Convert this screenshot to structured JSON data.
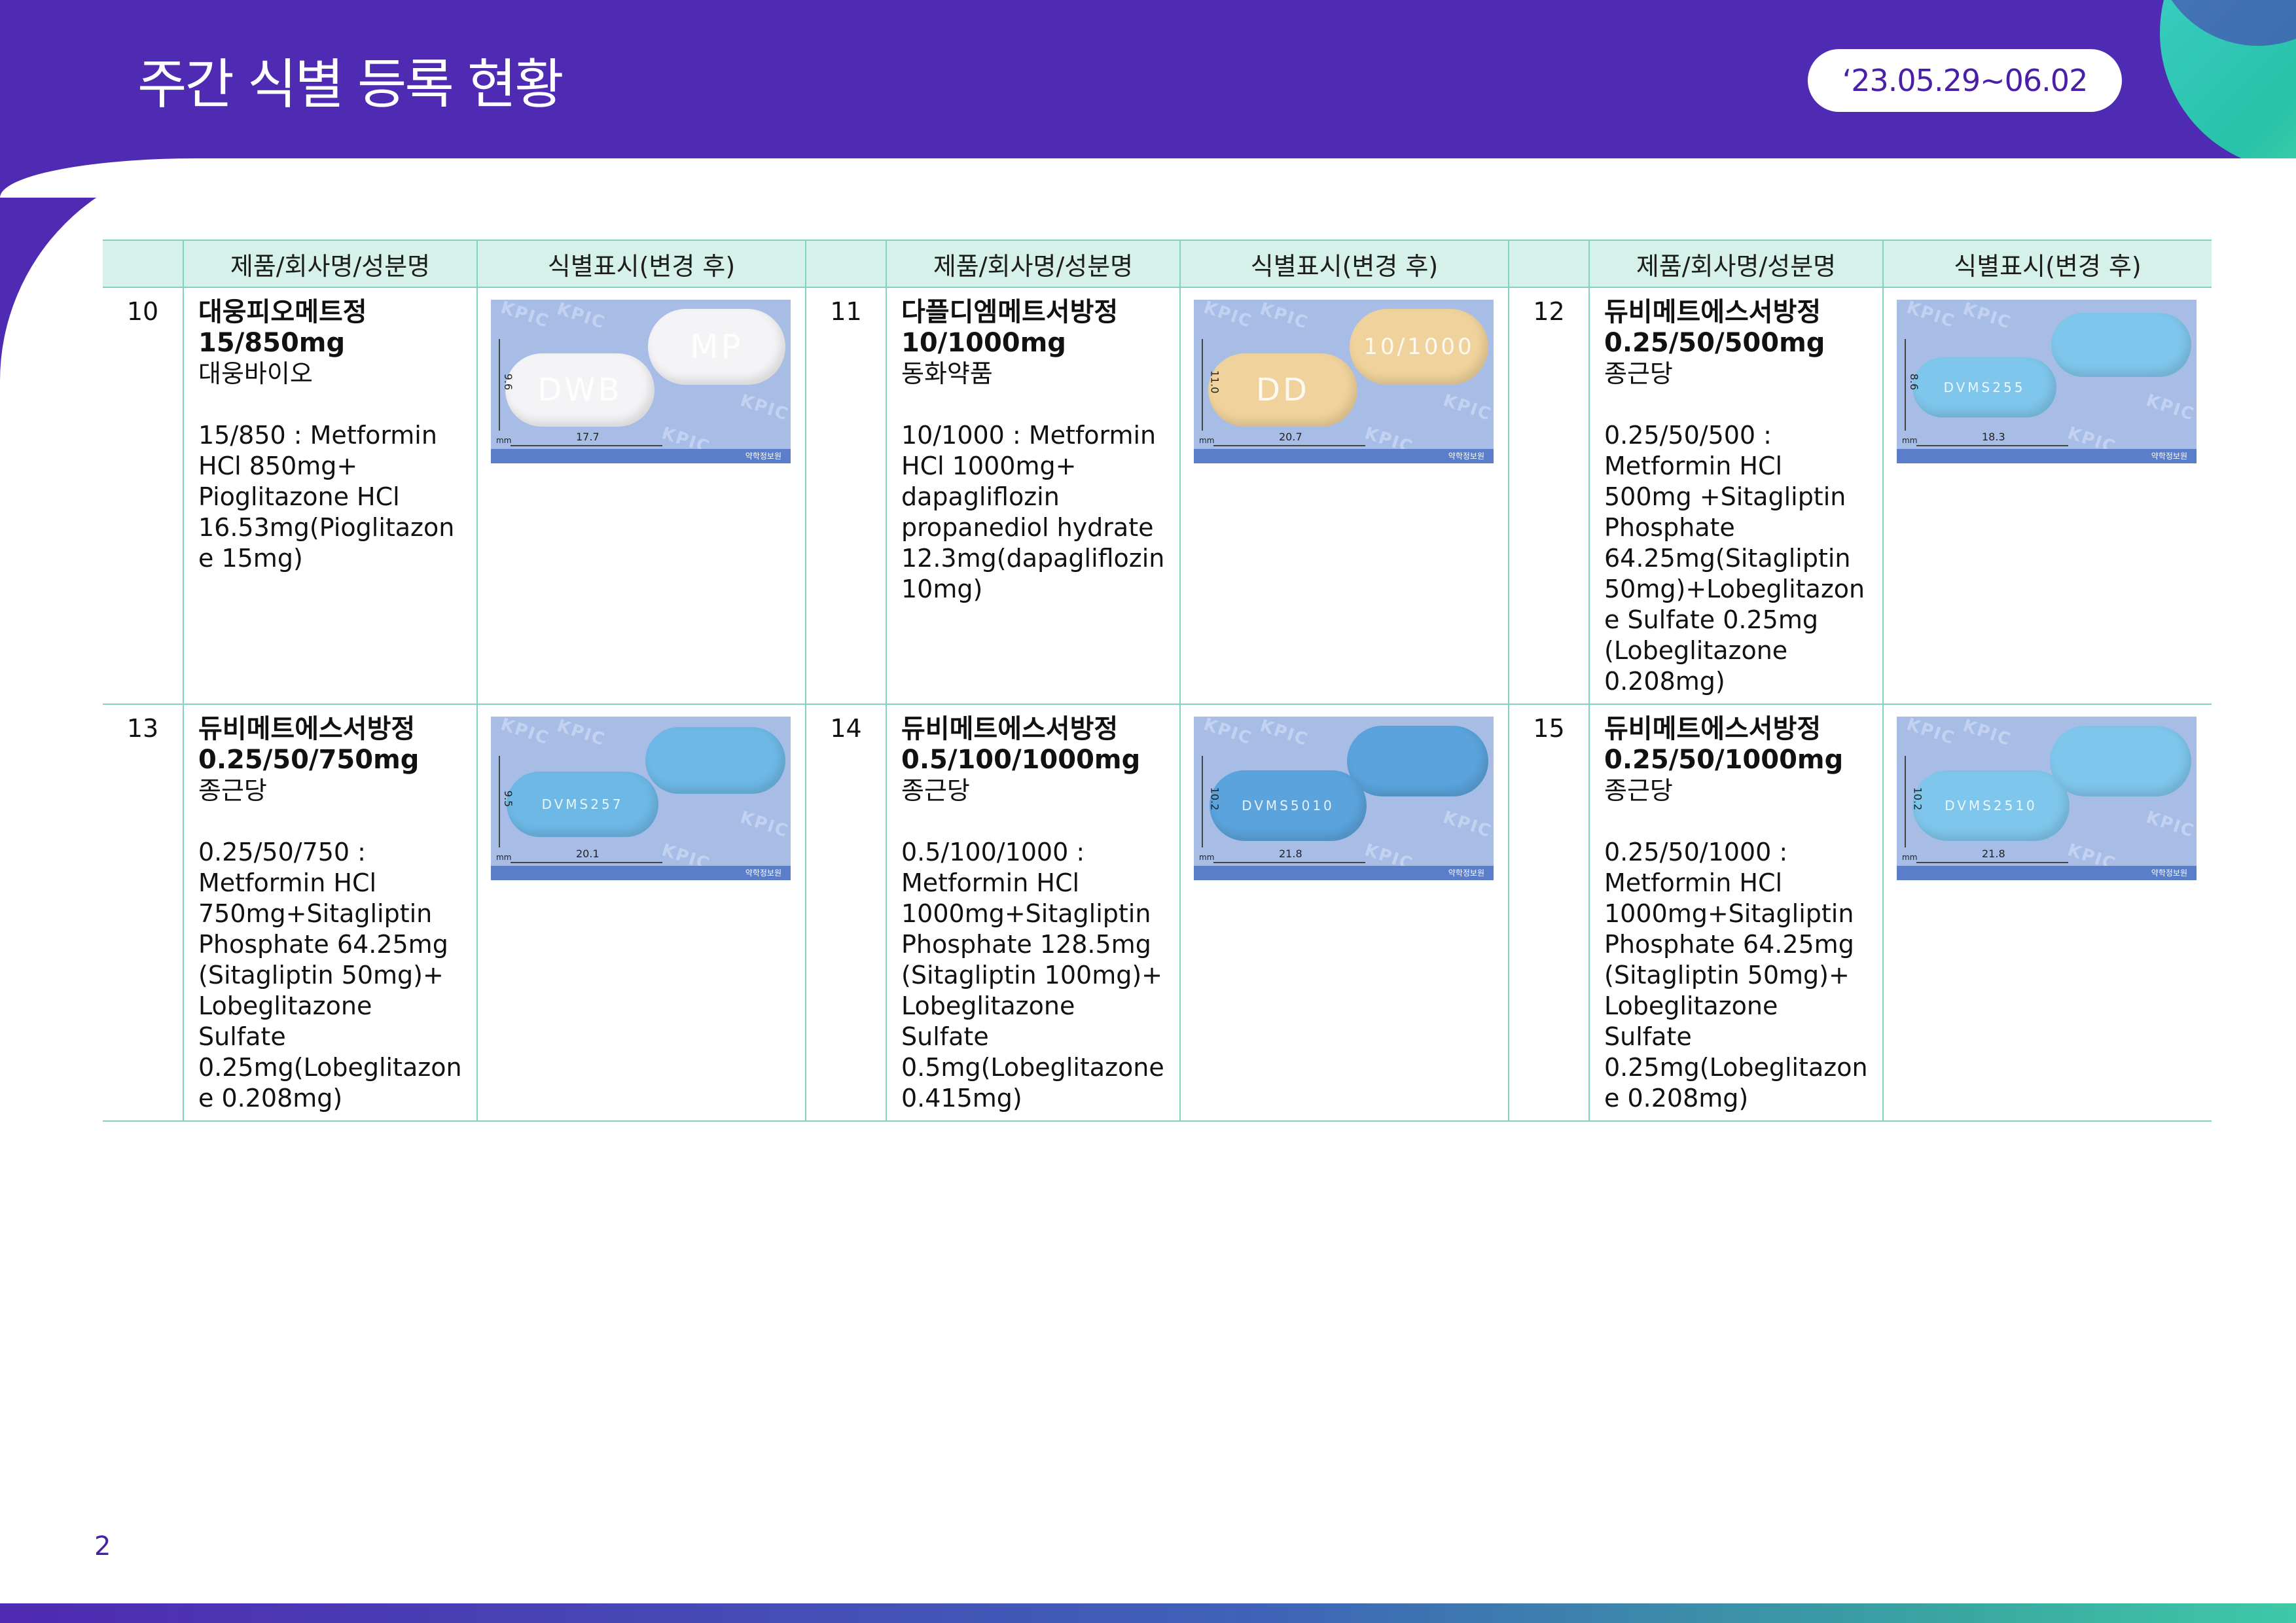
{
  "header": {
    "title": "주간 식별 등록 현황",
    "date_range": "‘23.05.29~06.02"
  },
  "table": {
    "headers": [
      "제품/회사명/성분명",
      "식별표시(변경 후)"
    ],
    "rows": [
      [
        {
          "no": "10",
          "name": "대웅피오메트정",
          "strength": "15/850mg",
          "company": "대웅바이오",
          "ingredients": "15/850 : Metformin HCl 850mg+ Pioglitazone HCl 16.53mg(Pioglitazone 15mg)",
          "image": {
            "height_label": "9.6",
            "length_label": "17.7",
            "unit": "mm",
            "brand": "약학정보원",
            "watermark": "KPIC",
            "front_mark": "DWB",
            "back_mark": "MP",
            "color": "#f4f4f6"
          }
        },
        {
          "no": "11",
          "name": "다플디엠메트서방정",
          "strength": "10/1000mg",
          "company": "동화약품",
          "ingredients": "10/1000 : Metformin HCl 1000mg+ dapagliflozin propanediol hydrate 12.3mg(dapagliflozin 10mg)",
          "image": {
            "height_label": "11.0",
            "length_label": "20.7",
            "unit": "mm",
            "brand": "약학정보원",
            "watermark": "KPIC",
            "front_mark": "DD",
            "back_mark": "10/1000",
            "color": "#f0d39c"
          }
        },
        {
          "no": "12",
          "name": "듀비메트에스서방정",
          "strength": "0.25/50/500mg",
          "company": "종근당",
          "ingredients": "0.25/50/500 : Metformin HCl 500mg +Sitagliptin Phosphate 64.25mg(Sitagliptin 50mg)+Lobeglitazone Sulfate 0.25mg (Lobeglitazone 0.208mg)",
          "image": {
            "height_label": "8.6",
            "length_label": "18.3",
            "unit": "mm",
            "brand": "약학정보원",
            "watermark": "KPIC",
            "front_mark": "DVMS255",
            "back_mark": "",
            "color": "#7fc6ec"
          }
        }
      ],
      [
        {
          "no": "13",
          "name": "듀비메트에스서방정",
          "strength": "0.25/50/750mg",
          "company": "종근당",
          "ingredients": "0.25/50/750 : Metformin HCl 750mg+Sitagliptin Phosphate 64.25mg (Sitagliptin 50mg)+ Lobeglitazone Sulfate 0.25mg(Lobeglitazone 0.208mg)",
          "image": {
            "height_label": "9.5",
            "length_label": "20.1",
            "unit": "mm",
            "brand": "약학정보원",
            "watermark": "KPIC",
            "front_mark": "DVMS257",
            "back_mark": "",
            "color": "#6eb8e6"
          }
        },
        {
          "no": "14",
          "name": "듀비메트에스서방정",
          "strength": "0.5/100/1000mg",
          "company": "종근당",
          "ingredients": "0.5/100/1000 : Metformin HCl 1000mg+Sitagliptin Phosphate 128.5mg (Sitagliptin 100mg)+ Lobeglitazone Sulfate 0.5mg(Lobeglitazone 0.415mg)",
          "image": {
            "height_label": "10.2",
            "length_label": "21.8",
            "unit": "mm",
            "brand": "약학정보원",
            "watermark": "KPIC",
            "front_mark": "DVMS5010",
            "back_mark": "",
            "color": "#5aa3dc"
          }
        },
        {
          "no": "15",
          "name": "듀비메트에스서방정",
          "strength": "0.25/50/1000mg",
          "company": "종근당",
          "ingredients": "0.25/50/1000 : Metformin HCl 1000mg+Sitagliptin Phosphate 64.25mg (Sitagliptin 50mg)+ Lobeglitazone Sulfate 0.25mg(Lobeglitazone 0.208mg)",
          "image": {
            "height_label": "10.2",
            "length_label": "21.8",
            "unit": "mm",
            "brand": "약학정보원",
            "watermark": "KPIC",
            "front_mark": "DVMS2510",
            "back_mark": "",
            "color": "#7fc6ec"
          }
        }
      ]
    ]
  },
  "footer": {
    "page_number": "2",
    "bar_colors": [
      "#4f2ab2",
      "#3fc9a8"
    ]
  },
  "colors": {
    "header_purple": "#4f2ab2",
    "header_row_bg": "#d6f0ea",
    "border_teal": "#7fd3c0",
    "date_text": "#4a1fa8"
  }
}
